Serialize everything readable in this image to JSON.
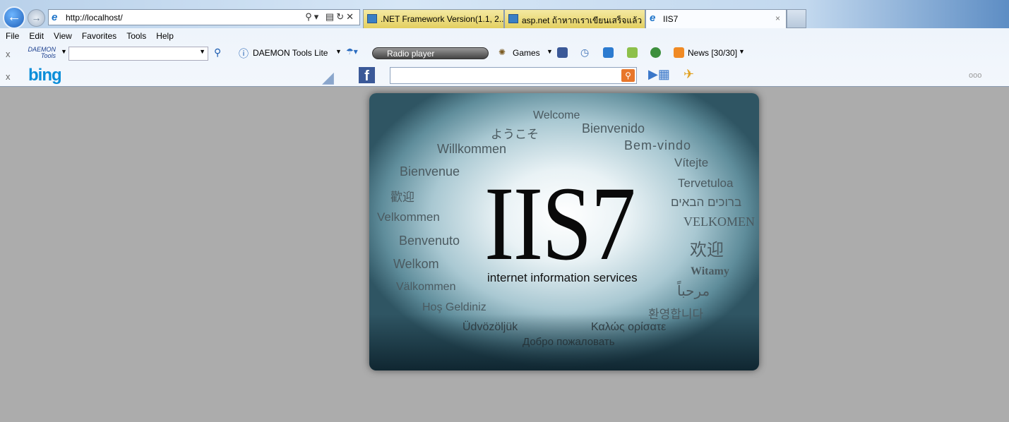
{
  "browser": {
    "address_url": "http://localhost/",
    "tabs": [
      {
        "label": ".NET Framework Version(1.1, 2....",
        "active": false
      },
      {
        "label": "asp.net ถ้าหากเราเขียนเสร็จแล้ว ...",
        "active": false
      },
      {
        "label": "IIS7",
        "active": true
      }
    ],
    "menu": [
      "File",
      "Edit",
      "View",
      "Favorites",
      "Tools",
      "Help"
    ],
    "toolbar1": {
      "close": "x",
      "daemon_logo": "DAEMON Tools",
      "daemon_label": "DAEMON Tools Lite",
      "radio_label": "Radio player",
      "games_label": "Games",
      "news_label": "News [30/30]"
    },
    "toolbar2": {
      "close": "x",
      "bing_logo": "bing",
      "search_value": "",
      "more": "ooo"
    }
  },
  "page": {
    "logo": "IIS7",
    "subtitle": "internet information services",
    "welcome_words": [
      "Welcome",
      "ようこそ",
      "Bienvenido",
      "Willkommen",
      "Bem-vindo",
      "Bienvenue",
      "Vítejte",
      "歡迎",
      "Tervetuloa",
      "ברוכים הבאים",
      "Velkommen",
      "VELKOMEN",
      "Benvenuto",
      "欢迎",
      "Welkom",
      "Witamy",
      "Välkommen",
      "مرحباً",
      "Hoş Geldiniz",
      "환영합니다",
      "Üdvözöljük",
      "Καλώς ορίσατε",
      "Добро пожаловать"
    ]
  }
}
